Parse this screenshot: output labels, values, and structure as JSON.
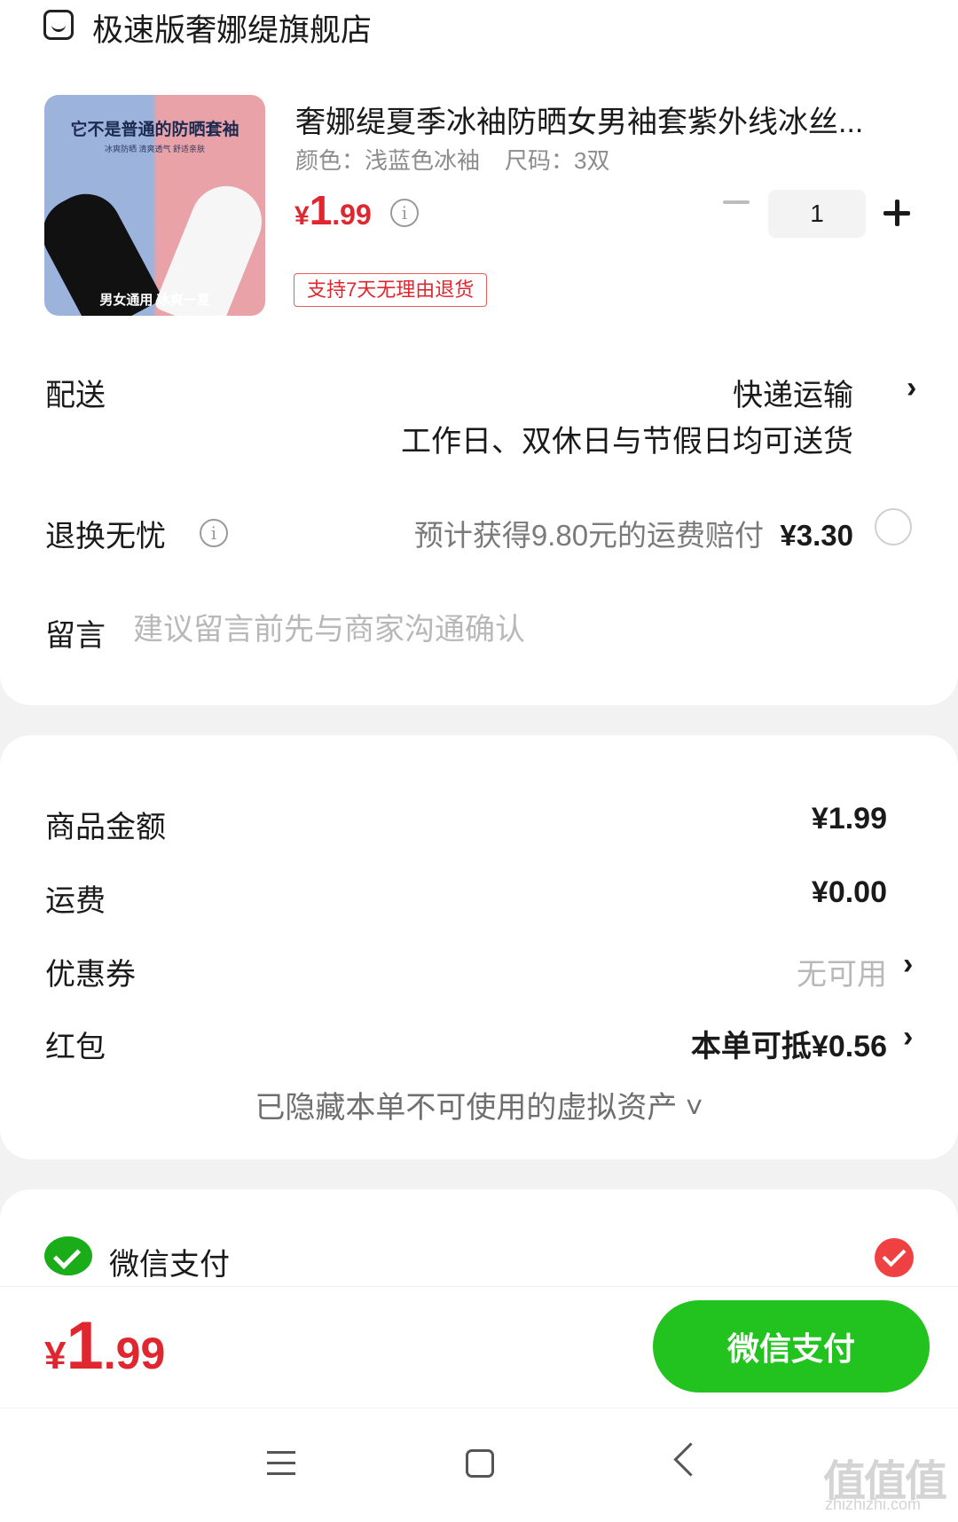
{
  "shop": {
    "name": "极速版奢娜缇旗舰店",
    "icon": "shop-icon"
  },
  "product": {
    "image_text_top": "它不是普通的防晒套袖",
    "image_text_sub": "冰爽防晒 清爽透气 舒适亲肤",
    "image_text_bottom": "男女通用 冰爽一夏",
    "title": "奢娜缇夏季冰袖防晒女男袖套紫外线冰丝...",
    "spec_color": "颜色：浅蓝色冰袖",
    "spec_size": "尺码：3双",
    "price_currency": "¥",
    "price_int": "1",
    "price_dec": ".99",
    "info_icon": "i",
    "quantity": "1",
    "return_tag": "支持7天无理由退货"
  },
  "delivery": {
    "label": "配送",
    "value": "快递运输",
    "note": "工作日、双休日与节假日均可送货",
    "chevron": "›"
  },
  "returns": {
    "label": "退换无忧",
    "info_icon": "i",
    "note": "预计获得9.80元的运费赔付",
    "price": "¥3.30"
  },
  "message": {
    "label": "留言",
    "placeholder": "建议留言前先与商家沟通确认"
  },
  "summary": {
    "goods_label": "商品金额",
    "goods_value": "¥1.99",
    "shipping_label": "运费",
    "shipping_value": "¥0.00",
    "coupon_label": "优惠券",
    "coupon_value": "无可用",
    "redpacket_label": "红包",
    "redpacket_value": "本单可抵¥0.56",
    "chevron": "›",
    "hidden_assets": "已隐藏本单不可使用的虚拟资产 ˅"
  },
  "payment": {
    "method": "微信支付",
    "selected": true
  },
  "footer": {
    "total_currency": "¥",
    "total_int": "1",
    "total_dec": ".99",
    "pay_button": "微信支付"
  },
  "watermark": {
    "text": "值值值",
    "sub": "zhizhizhi.com"
  },
  "colors": {
    "accent_red": "#e0262e",
    "wechat_green": "#22c21f",
    "background": "#f2f2f2"
  }
}
